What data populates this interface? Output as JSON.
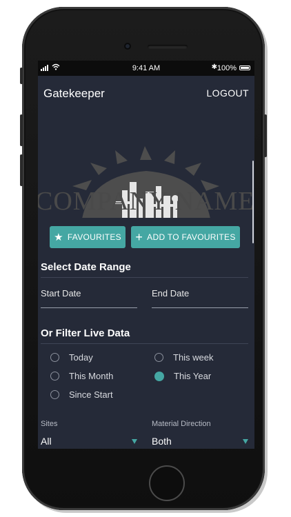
{
  "status": {
    "time": "9:41 AM",
    "battery": "100%"
  },
  "appbar": {
    "title": "Gatekeeper",
    "logout_label": "LOGOUT"
  },
  "logo": {
    "text": "COMPANY NAME"
  },
  "actions": {
    "favourites_label": "FAVOURITES",
    "add_favourites_label": "ADD TO FAVOURITES"
  },
  "date_range": {
    "title": "Select Date Range",
    "start_placeholder": "Start Date",
    "end_placeholder": "End Date"
  },
  "filter": {
    "title": "Or Filter Live Data",
    "options": [
      {
        "label": "Today",
        "checked": false
      },
      {
        "label": "This week",
        "checked": false
      },
      {
        "label": "This Month",
        "checked": false
      },
      {
        "label": "This Year",
        "checked": true
      },
      {
        "label": "Since Start",
        "checked": false
      }
    ]
  },
  "selects": {
    "sites_label": "Sites",
    "sites_value": "All",
    "direction_label": "Material Direction",
    "direction_value": "Both"
  },
  "colors": {
    "accent": "#45a7a3",
    "screen_bg": "#252a38"
  }
}
